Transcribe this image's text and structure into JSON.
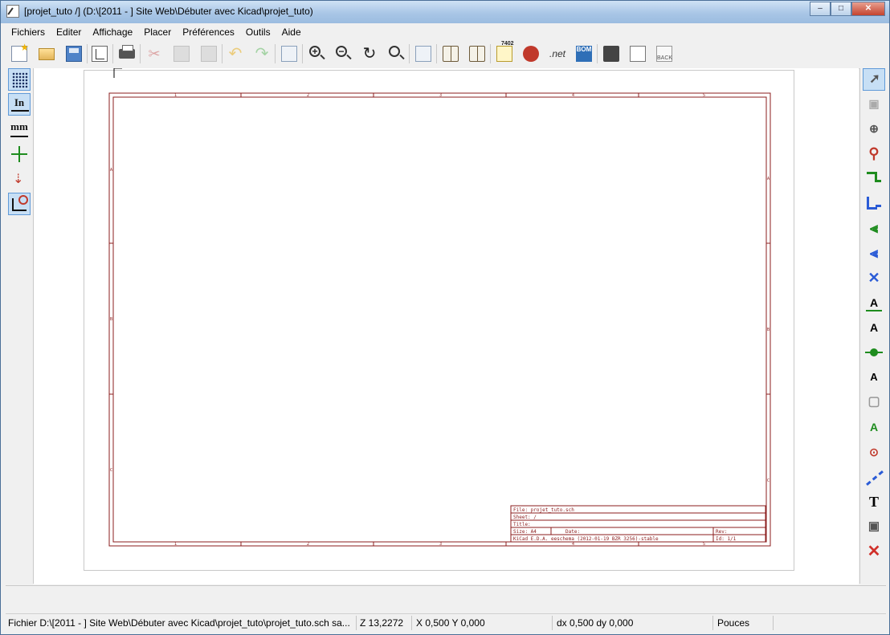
{
  "window": {
    "title": "[projet_tuto /] (D:\\[2011 - ] Site Web\\Débuter avec Kicad\\projet_tuto)",
    "minimize_symbol": "–",
    "maximize_symbol": "□",
    "close_symbol": "✕"
  },
  "menubar": {
    "items": [
      "Fichiers",
      "Editer",
      "Affichage",
      "Placer",
      "Préférences",
      "Outils",
      "Aide"
    ]
  },
  "toolbar": {
    "icons": [
      "new-schematic-icon",
      "open-schematic-icon",
      "save-icon",
      "page-settings-icon",
      "print-icon",
      "cut-icon",
      "copy-icon",
      "paste-icon",
      "undo-icon",
      "redo-icon",
      "find-icon",
      "zoom-in-icon",
      "zoom-out-icon",
      "redraw-icon",
      "zoom-fit-icon",
      "hierarchy-navigator-icon",
      "library-editor-icon",
      "library-browser-icon",
      "annotate-icon",
      "erc-icon",
      "netlist-icon",
      "bom-icon",
      "cvpcb-icon",
      "pcbnew-icon",
      "back-annotate-icon"
    ],
    "annotate_label": "7402",
    "netlist_label": ".net",
    "bom_label": "BOM",
    "back_label": "BACK"
  },
  "left_toolbar": {
    "icons": [
      "grid-toggle-icon",
      "inch-units-icon",
      "mm-units-icon",
      "cursor-shape-icon",
      "hidden-pins-icon",
      "wire-bus-orientation-icon"
    ],
    "inch_label": "In",
    "mm_label": "mm"
  },
  "right_toolbar": {
    "icons": [
      "select-arrow-icon",
      "hierarchy-push-pop-icon",
      "place-component-icon",
      "place-power-icon",
      "place-wire-icon",
      "place-bus-icon",
      "wire-to-bus-entry-icon",
      "bus-to-bus-entry-icon",
      "no-connect-icon",
      "net-label-icon",
      "global-label-icon",
      "junction-icon",
      "hierarchical-label-icon",
      "hierarchical-sheet-icon",
      "import-sheet-pin-icon",
      "place-sheet-pin-icon",
      "graphic-line-icon",
      "graphic-text-icon",
      "image-icon",
      "delete-icon"
    ],
    "text_tool_glyph": "T",
    "no_connect_glyph": "✕",
    "delete_glyph": "✕"
  },
  "sheet": {
    "col_numbers": [
      "1",
      "2",
      "3",
      "4",
      "5"
    ],
    "row_letters": [
      "A",
      "B",
      "C"
    ],
    "title_block": {
      "file": "File: projet_tuto.sch",
      "sheet": "Sheet: /",
      "title": "Title:",
      "size": "Size: A4",
      "date": "Date:",
      "rev": "Rev:",
      "kicad": "KiCad E.D.A.  eeschema (2012-01-19 BZR 3256)-stable",
      "id": "Id: 1/1"
    }
  },
  "statusbar": {
    "file_status": "Fichier D:\\[2011 - ] Site Web\\Débuter avec Kicad\\projet_tuto\\projet_tuto.sch sa...",
    "zoom": "Z 13,2272",
    "xy": "X 0,500  Y 0,000",
    "dxdy": "dx 0,500  dy 0,000",
    "units": "Pouces"
  },
  "colors": {
    "sheet_border": "#8b1c1c",
    "canvas": "#ffffff",
    "active_tool": "#c7dff5",
    "wire_tool": "#1e8c1e",
    "bus_tool": "#2a5bd6",
    "power_tool": "#c0392b"
  }
}
